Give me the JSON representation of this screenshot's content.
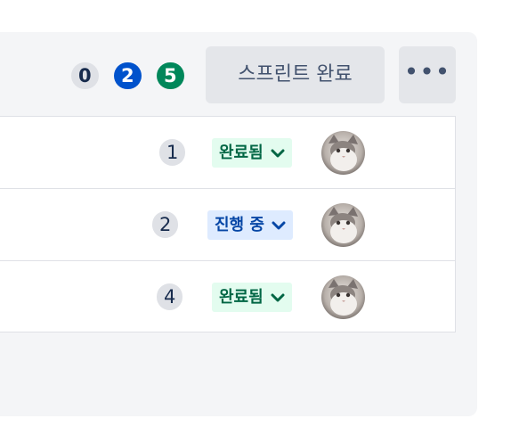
{
  "sprint": {
    "counts": {
      "todo": "0",
      "in_progress": "2",
      "done": "5"
    },
    "complete_button_label": "스프린트 완료",
    "more_button_label": "•••"
  },
  "issues": [
    {
      "points": "1",
      "status": "완료됨",
      "status_type": "done"
    },
    {
      "points": "2",
      "status": "진행 중",
      "status_type": "in-progress"
    },
    {
      "points": "4",
      "status": "완료됨",
      "status_type": "done"
    }
  ],
  "colors": {
    "panel_bg": "#f4f5f7",
    "done_badge_bg": "#00875a",
    "in_progress_badge_bg": "#0052cc",
    "done_status_bg": "#e3fcef",
    "done_status_text": "#006644",
    "in_progress_status_bg": "#deebff",
    "in_progress_status_text": "#0747a6"
  }
}
